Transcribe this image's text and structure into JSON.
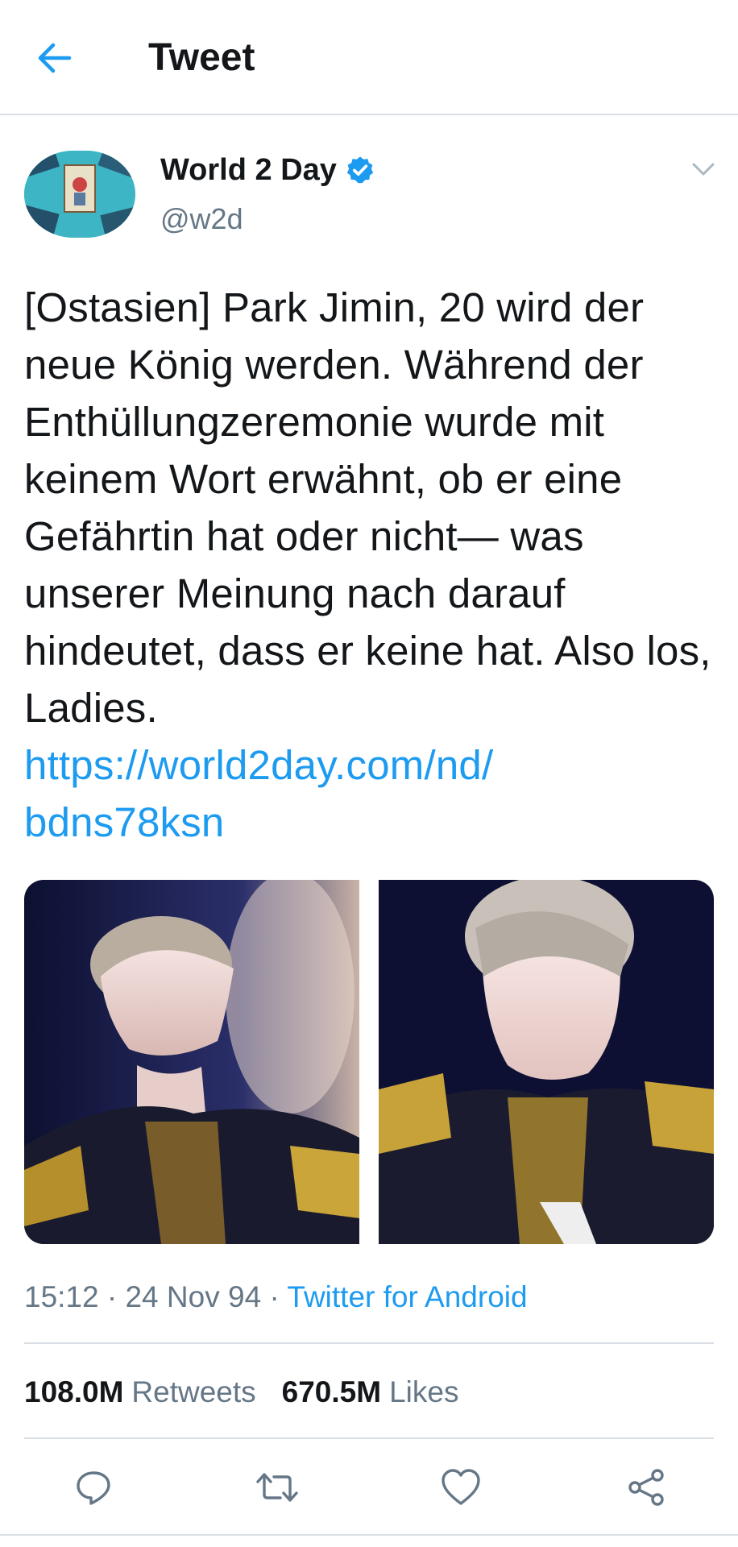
{
  "header": {
    "title": "Tweet",
    "back_icon": "arrow-left-icon"
  },
  "colors": {
    "accent": "#1d9bf0",
    "text": "#14171a",
    "muted": "#657786",
    "divider": "#d9dfe4"
  },
  "author": {
    "name": "World 2 Day",
    "handle": "@w2d",
    "verified": true
  },
  "tweet": {
    "text": "[Ostasien] Park Jimin, 20 wird der neue König werden. Während der Enthüllungzeremonie wurde mit keinem Wort erwähnt, ob er eine Gefährtin hat oder nicht— was unserer Meinung nach darauf hindeutet, dass er keine hat. Also los, Ladies.",
    "link_line1": "https://world2day.com/nd/",
    "link_line2": "bdns78ksn"
  },
  "meta": {
    "time": "15:12",
    "date": "24 Nov 94",
    "separator": "·",
    "source": "Twitter for Android"
  },
  "stats": {
    "retweets_count": "108.0M",
    "retweets_label": "Retweets",
    "likes_count": "670.5M",
    "likes_label": "Likes"
  },
  "actions": [
    "reply-icon",
    "retweet-icon",
    "like-icon",
    "share-icon"
  ]
}
